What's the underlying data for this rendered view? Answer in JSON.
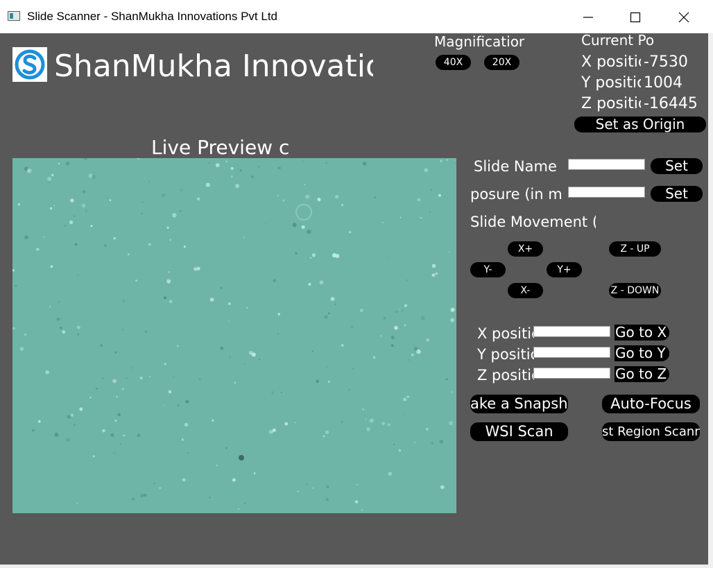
{
  "window": {
    "title": "Slide Scanner - ShanMukha Innovations Pvt Ltd"
  },
  "brand": {
    "name": "ShanMukha Innovatio",
    "logo_letter": "S"
  },
  "magnification": {
    "label": "Magnificatior",
    "options": [
      "40X",
      "20X"
    ]
  },
  "position": {
    "header": "Current Posit",
    "x_label": "X positic",
    "x_value": "-7530",
    "y_label": "Y positic",
    "y_value": "1004",
    "z_label": "Z positic",
    "z_value": "-16445",
    "set_origin_label": "Set as Origin"
  },
  "preview": {
    "label": "Live Preview c",
    "background_color": "#6fb5a7"
  },
  "slide_name": {
    "label": "Slide Name",
    "value": "",
    "set_label": "Set"
  },
  "exposure": {
    "label": "posure (in m",
    "value": "",
    "set_label": "Set"
  },
  "movement": {
    "label": "Slide Movement (",
    "x_plus": "X+",
    "x_minus": "X-",
    "y_minus": "Y-",
    "y_plus": "Y+",
    "z_up": "Z - UP",
    "z_down": "Z - DOWN"
  },
  "goto": {
    "x_label": "X positic",
    "y_label": "Y positic",
    "z_label": "Z positic",
    "x_value": "",
    "y_value": "",
    "z_value": "",
    "go_x": "Go to X",
    "go_y": "Go to Y",
    "go_z": "Go to Z"
  },
  "actions": {
    "snapshot": "ake a Snapsho",
    "autofocus": "Auto-Focus",
    "wsi_scan": "WSI Scan",
    "region_scan": "st Region Scanni"
  },
  "icons": {
    "app": "app-window-icon",
    "minimize": "minimize-icon",
    "maximize": "maximize-icon",
    "close": "close-icon",
    "logo": "shanmukha-logo"
  },
  "colors": {
    "window_bg": "#585858",
    "button_bg": "#000000",
    "logo_blue": "#1d8fd8"
  }
}
